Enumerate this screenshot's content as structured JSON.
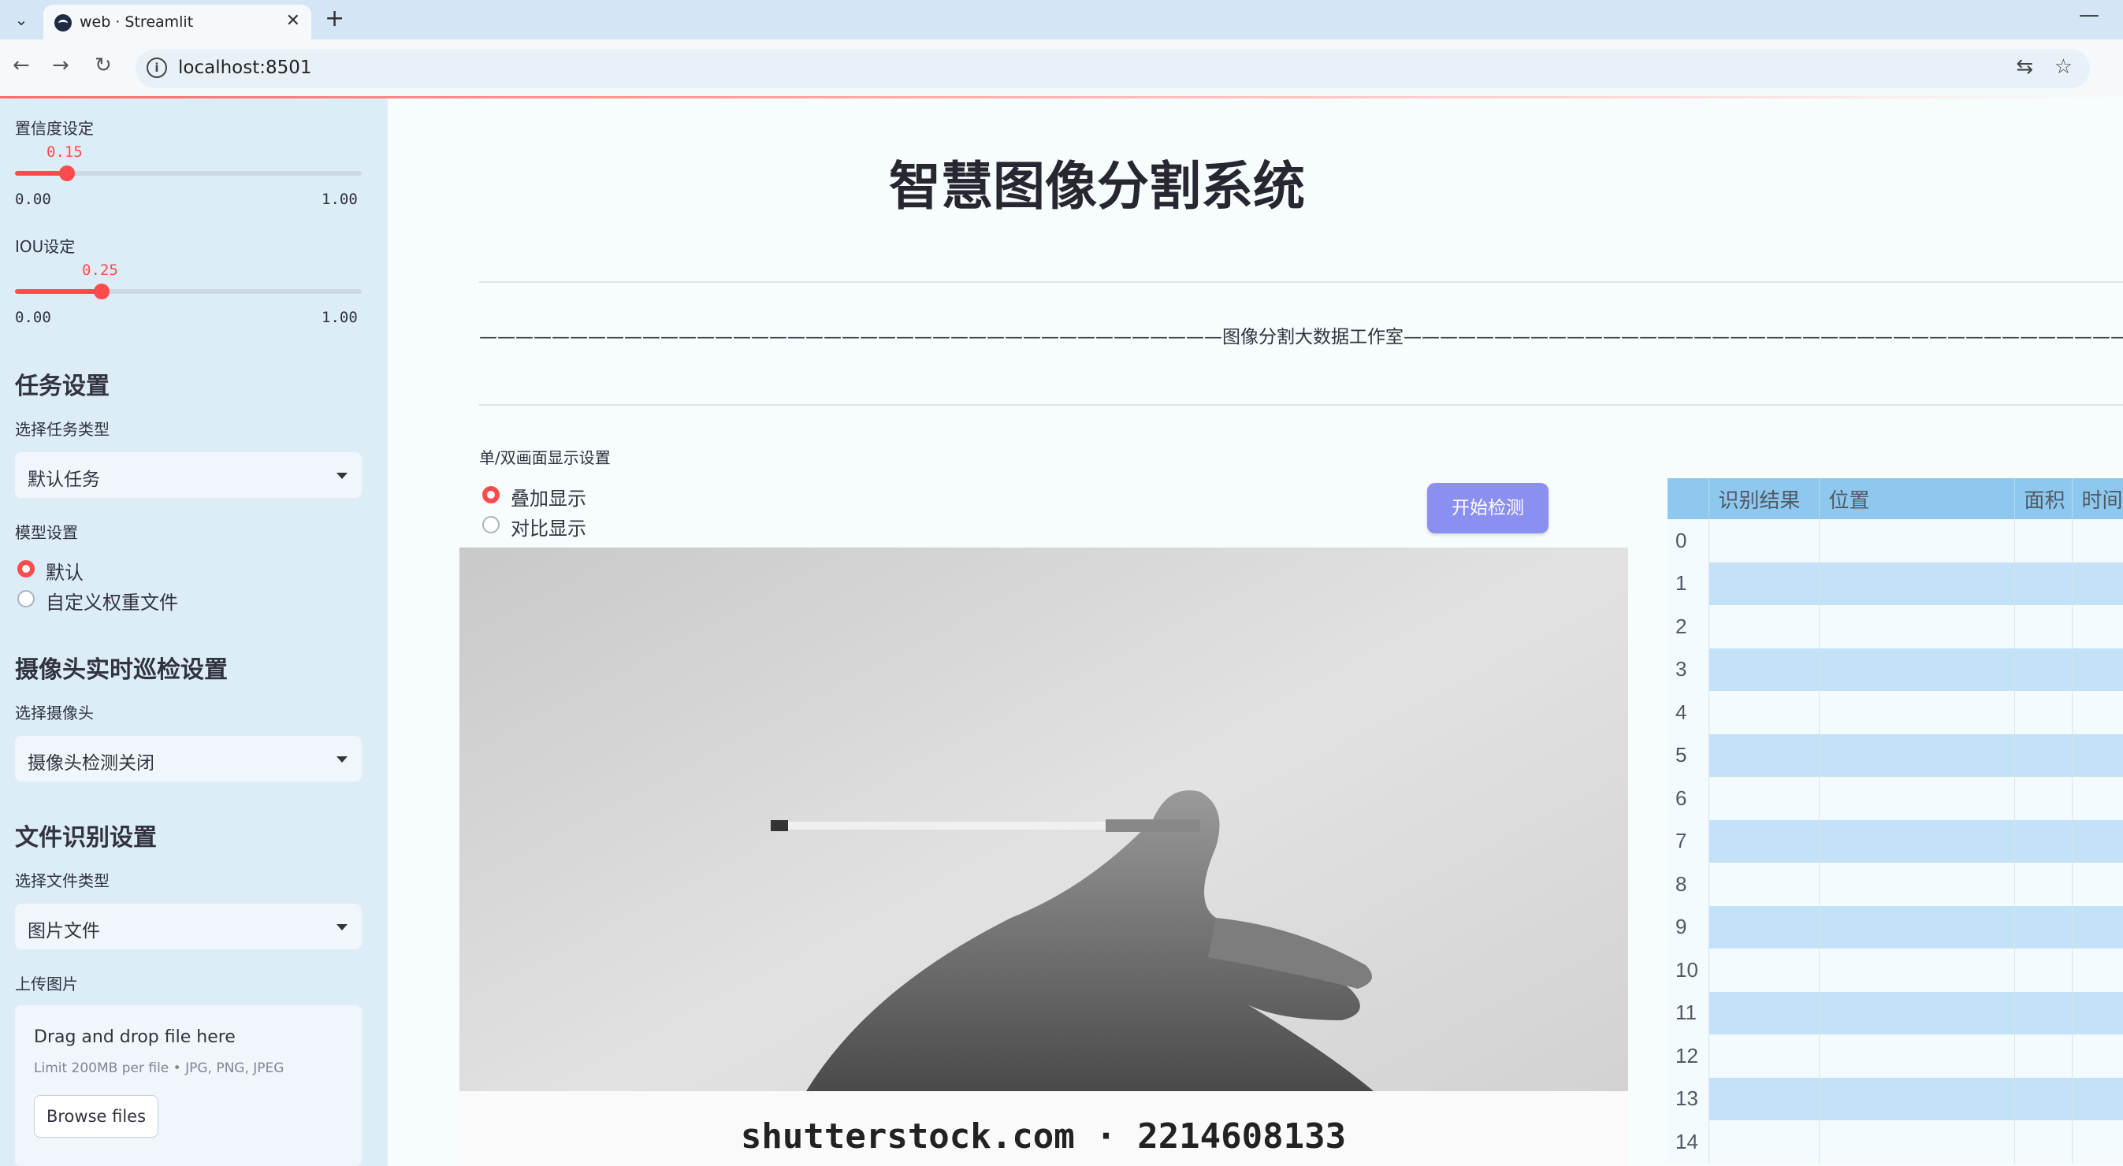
{
  "browser": {
    "tab_title": "web · Streamlit",
    "url": "localhost:8501"
  },
  "sidebar": {
    "confidence": {
      "label": "置信度设定",
      "value": "0.15",
      "value_fraction": 0.15,
      "min": "0.00",
      "max": "1.00"
    },
    "iou": {
      "label": "IOU设定",
      "value": "0.25",
      "value_fraction": 0.25,
      "min": "0.00",
      "max": "1.00"
    },
    "task_section": "任务设置",
    "task_type_label": "选择任务类型",
    "task_type_value": "默认任务",
    "model_label": "模型设置",
    "model_options": [
      "默认",
      "自定义权重文件"
    ],
    "model_selected": 0,
    "camera_section": "摄像头实时巡检设置",
    "camera_label": "选择摄像头",
    "camera_value": "摄像头检测关闭",
    "file_section": "文件识别设置",
    "file_type_label": "选择文件类型",
    "file_type_value": "图片文件",
    "upload_label": "上传图片",
    "uploader": {
      "title": "Drag and drop file here",
      "limit": "Limit 200MB per file • JPG, PNG, JPEG",
      "button": "Browse files"
    }
  },
  "main": {
    "title": "智慧图像分割系统",
    "studio": "—————————————————————————————————————————图像分割大数据工作室—————————————————————————————————————————",
    "display_label": "单/双画面显示设置",
    "display_options": [
      "叠加显示",
      "对比显示"
    ],
    "display_selected": 0,
    "start_button": "开始检测",
    "image_watermark": "shutterstock.com · 2214608133",
    "table": {
      "columns": [
        "",
        "识别结果",
        "位置",
        "面积",
        "时间"
      ],
      "rows": [
        "0",
        "1",
        "2",
        "3",
        "4",
        "5",
        "6",
        "7",
        "8",
        "9",
        "10",
        "11",
        "12",
        "13",
        "14"
      ]
    }
  },
  "colors": {
    "accent": "#ff4b4b",
    "button": "#8b8ff0",
    "sidebar": "#dcedf8",
    "table_header": "#8ec8ee"
  }
}
